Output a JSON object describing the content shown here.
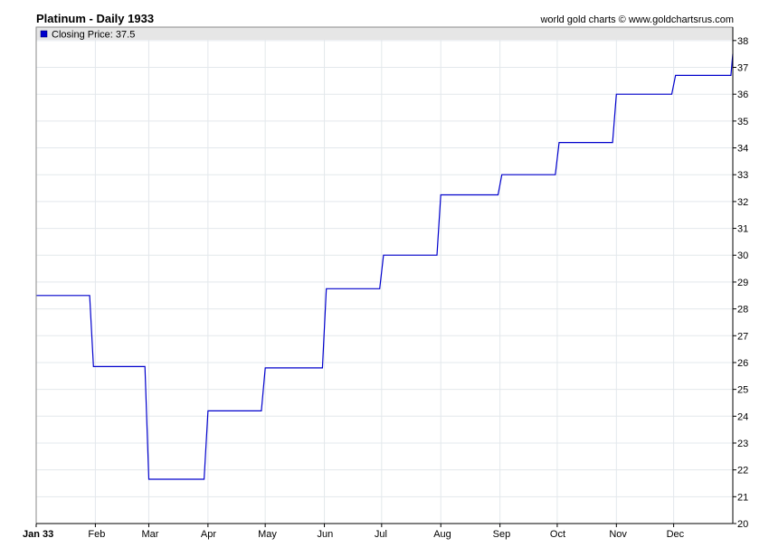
{
  "header": {
    "title": "Platinum - Daily 1933",
    "credit": "world gold charts © www.goldchartsrus.com"
  },
  "chart_data": {
    "type": "line",
    "title": "Platinum - Daily 1933",
    "legend": {
      "label": "Closing Price: 37.5",
      "placement": "top-left",
      "color": "#0000cc"
    },
    "series_color": "#0000cc",
    "grid": true,
    "xlim": [
      0,
      365
    ],
    "ylim": [
      20,
      38.5
    ],
    "y_ticks": [
      20,
      21,
      22,
      23,
      24,
      25,
      26,
      27,
      28,
      29,
      30,
      31,
      32,
      33,
      34,
      35,
      36,
      37,
      38
    ],
    "x_ticks": [
      {
        "label": "Jan 33",
        "day": 0,
        "bold": true
      },
      {
        "label": "Feb",
        "day": 31
      },
      {
        "label": "Mar",
        "day": 59
      },
      {
        "label": "Apr",
        "day": 90
      },
      {
        "label": "May",
        "day": 120
      },
      {
        "label": "Jun",
        "day": 151
      },
      {
        "label": "Jul",
        "day": 181
      },
      {
        "label": "Aug",
        "day": 212
      },
      {
        "label": "Sep",
        "day": 243
      },
      {
        "label": "Oct",
        "day": 273
      },
      {
        "label": "Nov",
        "day": 304
      },
      {
        "label": "Dec",
        "day": 334
      }
    ],
    "points": [
      {
        "x": 0,
        "y": 28.5
      },
      {
        "x": 28,
        "y": 28.5
      },
      {
        "x": 30,
        "y": 25.85
      },
      {
        "x": 57,
        "y": 25.85
      },
      {
        "x": 59,
        "y": 21.65
      },
      {
        "x": 88,
        "y": 21.65
      },
      {
        "x": 90,
        "y": 24.2
      },
      {
        "x": 118,
        "y": 24.2
      },
      {
        "x": 120,
        "y": 25.8
      },
      {
        "x": 150,
        "y": 25.8
      },
      {
        "x": 152,
        "y": 28.75
      },
      {
        "x": 180,
        "y": 28.75
      },
      {
        "x": 182,
        "y": 30.0
      },
      {
        "x": 210,
        "y": 30.0
      },
      {
        "x": 212,
        "y": 32.25
      },
      {
        "x": 242,
        "y": 32.25
      },
      {
        "x": 244,
        "y": 33.0
      },
      {
        "x": 272,
        "y": 33.0
      },
      {
        "x": 274,
        "y": 34.2
      },
      {
        "x": 302,
        "y": 34.2
      },
      {
        "x": 304,
        "y": 36.0
      },
      {
        "x": 333,
        "y": 36.0
      },
      {
        "x": 335,
        "y": 36.7
      },
      {
        "x": 364,
        "y": 36.7
      },
      {
        "x": 365,
        "y": 37.5
      }
    ]
  }
}
